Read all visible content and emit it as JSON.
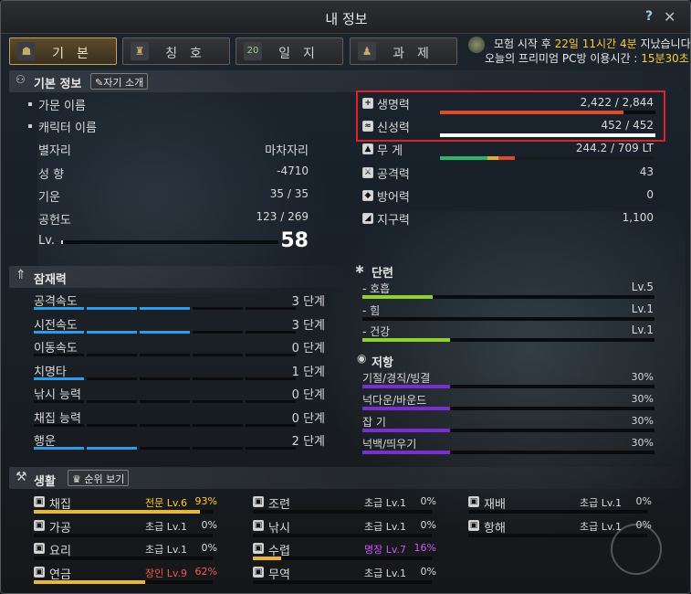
{
  "window": {
    "title": "내 정보",
    "help": "?",
    "close": "✕"
  },
  "tabs": [
    {
      "label": "기본",
      "icon": "person-icon",
      "active": true
    },
    {
      "label": "칭호",
      "icon": "title-icon",
      "active": false
    },
    {
      "label": "일지",
      "icon": "calendar-icon",
      "badge": "20",
      "active": false
    },
    {
      "label": "과제",
      "icon": "quest-icon",
      "active": false
    }
  ],
  "notice": {
    "line1_pre": "모험 시작 후 ",
    "line1_time": "22일 11시간 4분",
    "line1_post": " 지났습니다",
    "line2_pre": "오늘의 프리미엄 PC방 이용시간 : ",
    "line2_time": "15분30초"
  },
  "basic": {
    "header": "기본 정보",
    "intro_button": "자기 소개",
    "family_name_label": "가문 이름",
    "character_name_label": "캐릭터 이름",
    "rows": [
      {
        "label": "별자리",
        "value": "마차자리"
      },
      {
        "label": "성 향",
        "value": "-4710"
      },
      {
        "label": "기운",
        "value": "35 / 35"
      },
      {
        "label": "공헌도",
        "value": "123 / 269"
      }
    ],
    "level_label": "Lv.",
    "level_value": "58",
    "level_progress": 0.01
  },
  "vitals": {
    "hp_label": "생명력",
    "hp_value": "2,422 / 2,844",
    "hp_fraction": 0.85,
    "sp_label": "신성력",
    "sp_value": "452 / 452",
    "sp_fraction": 1.0,
    "weight_label": "무 게",
    "weight_value": "244.2 / 709 LT",
    "attack_label": "공격력",
    "attack_value": "43",
    "defense_label": "방어력",
    "defense_value": "0",
    "stamina_label": "지구력",
    "stamina_value": "1,100"
  },
  "potential": {
    "header": "잠재력",
    "items": [
      {
        "label": "공격속도",
        "value": "3 단계",
        "level": 3
      },
      {
        "label": "시전속도",
        "value": "3 단계",
        "level": 3
      },
      {
        "label": "이동속도",
        "value": "0 단계",
        "level": 0
      },
      {
        "label": "치명타",
        "value": "1 단계",
        "level": 1
      },
      {
        "label": "낚시 능력",
        "value": "0 단계",
        "level": 0
      },
      {
        "label": "채집 능력",
        "value": "0 단계",
        "level": 0
      },
      {
        "label": "행운",
        "value": "2 단계",
        "level": 2
      }
    ]
  },
  "training": {
    "header": "단련",
    "items": [
      {
        "label": "- 호흡",
        "value": "Lv.5",
        "fraction": 0.24
      },
      {
        "label": "- 힘",
        "value": "Lv.1",
        "fraction": 0.0
      },
      {
        "label": "- 건강",
        "value": "Lv.1",
        "fraction": 0.3
      }
    ]
  },
  "resistance": {
    "header": "저항",
    "items": [
      {
        "label": "기절/경직/빙결",
        "value": "30%",
        "fraction": 0.3
      },
      {
        "label": "넉다운/바운드",
        "value": "30%",
        "fraction": 0.3
      },
      {
        "label": "잡 기",
        "value": "30%",
        "fraction": 0.3
      },
      {
        "label": "넉백/띄우기",
        "value": "30%",
        "fraction": 0.3
      }
    ]
  },
  "life": {
    "header": "생활",
    "rank_button": "순위 보기",
    "skills": [
      {
        "label": "채집",
        "grade": "전문 Lv.6",
        "pct": "93%",
        "fraction": 0.93,
        "accent": "#ffcc33",
        "icon": "gather-icon"
      },
      {
        "label": "가공",
        "grade": "초급 Lv.1",
        "pct": "0%",
        "fraction": 0.0,
        "accent": "#d8d8d8",
        "icon": "process-icon"
      },
      {
        "label": "요리",
        "grade": "초급 Lv.1",
        "pct": "0%",
        "fraction": 0.0,
        "accent": "#d8d8d8",
        "icon": "cook-icon"
      },
      {
        "label": "연금",
        "grade": "장인 Lv.9",
        "pct": "62%",
        "fraction": 0.62,
        "accent": "#ff5544",
        "icon": "alchemy-icon"
      },
      {
        "label": "조련",
        "grade": "초급 Lv.1",
        "pct": "0%",
        "fraction": 0.0,
        "accent": "#d8d8d8",
        "icon": "training-icon"
      },
      {
        "label": "낚시",
        "grade": "초급 Lv.1",
        "pct": "0%",
        "fraction": 0.0,
        "accent": "#d8d8d8",
        "icon": "fishing-icon"
      },
      {
        "label": "수렵",
        "grade": "명장 Lv.7",
        "pct": "16%",
        "fraction": 0.16,
        "accent": "#cc55ff",
        "icon": "hunting-icon"
      },
      {
        "label": "무역",
        "grade": "초급 Lv.1",
        "pct": "0%",
        "fraction": 0.0,
        "accent": "#d8d8d8",
        "icon": "trade-icon"
      },
      {
        "label": "재배",
        "grade": "초급 Lv.1",
        "pct": "0%",
        "fraction": 0.0,
        "accent": "#d8d8d8",
        "icon": "farming-icon"
      },
      {
        "label": "항해",
        "grade": "초급 Lv.1",
        "pct": "0%",
        "fraction": 0.0,
        "accent": "#d8d8d8",
        "icon": "sailing-icon"
      }
    ]
  },
  "colors": {
    "accent_gold": "#ffcc33",
    "hp_bar": "#e04a2c",
    "sp_bar": "#ffffff",
    "potential_blue": "#2e9be8",
    "training_green": "#8ed22e",
    "resistance_purple": "#7a2ed2",
    "highlight_red": "#e0202a"
  }
}
